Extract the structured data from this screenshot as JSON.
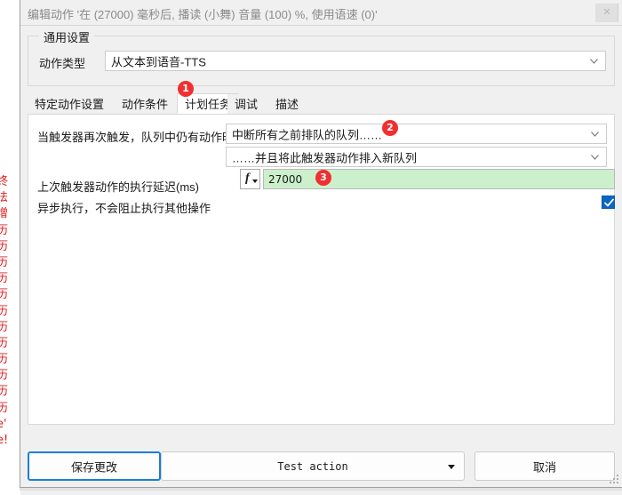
{
  "window": {
    "title": "编辑动作 '在 (27000) 毫秒后, 播读 (小舞) 音量 (100) %, 使用语速 (0)'",
    "close_label": "✕"
  },
  "background_window": {
    "lines": [
      "终",
      "法",
      "增",
      "历",
      "历",
      "历",
      "历",
      "历",
      "历",
      "历",
      "历",
      "历",
      "历",
      "历",
      "历",
      "e'",
      "e!"
    ]
  },
  "general_settings": {
    "group_title": "通用设置",
    "action_type_label": "动作类型",
    "action_type_value": "从文本到语音-TTS"
  },
  "tabs": [
    {
      "label": "特定动作设置",
      "active": false
    },
    {
      "label": "动作条件",
      "active": false
    },
    {
      "label": "计划任务",
      "active": true
    },
    {
      "label": "调试",
      "active": false
    },
    {
      "label": "描述",
      "active": false
    }
  ],
  "panel": {
    "retrigger_label": "当触发器再次触发，队列中仍有动作时",
    "retrigger_value": "中断所有之前排队的队列……",
    "retrigger_value_2": "……并且将此触发器动作排入新队列",
    "delay_label": "上次触发器动作的执行延迟(ms)",
    "delay_value": "27000",
    "fx_label": "f",
    "async_label": "异步执行，不会阻止执行其他操作",
    "async_checked": true
  },
  "badges": [
    {
      "number": "1"
    },
    {
      "number": "2"
    },
    {
      "number": "3"
    }
  ],
  "footer": {
    "save_label": "保存更改",
    "test_label": "Test action",
    "cancel_label": "取消"
  },
  "colors": {
    "accent": "#1a7fd4",
    "badge": "#f03030",
    "checkbox": "#0a66c2",
    "field_green": "#ccf0cc",
    "bg_text_red": "#e01b1b"
  }
}
